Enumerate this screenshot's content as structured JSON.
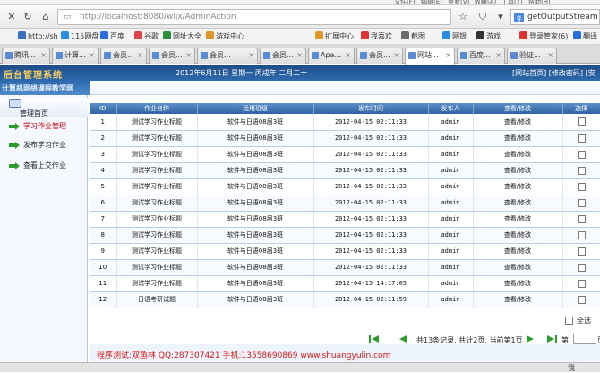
{
  "browser": {
    "url_host": "http://localhost",
    "url_path": ":8080/wljx/AdminAction",
    "search_text": "getOutputStream",
    "top_fragments": [
      "文件(F)",
      "编辑(E)",
      "查看(V)",
      "收藏(A)",
      "工具(T)",
      "帮助(H)"
    ],
    "bookmarks": [
      {
        "label": "http://sh",
        "color": "#3b6fc1"
      },
      {
        "label": "115网盘",
        "color": "#2a8de0"
      },
      {
        "label": "百度",
        "color": "#2a6be0"
      },
      {
        "label": "谷歌",
        "color": "#d44"
      },
      {
        "label": "网址大全",
        "color": "#2c8f3a"
      },
      {
        "label": "游戏中心",
        "color": "#e0962a"
      },
      {
        "label": "扩展中心",
        "color": "#e0962a"
      },
      {
        "label": "我喜欢",
        "color": "#d33"
      },
      {
        "label": "截图",
        "color": "#6b6b6b"
      },
      {
        "label": "网银",
        "color": "#2a8de0"
      },
      {
        "label": "游戏",
        "color": "#333"
      },
      {
        "label": "登录管家(6)",
        "color": "#d33"
      },
      {
        "label": "翻译",
        "color": "#2a6be0"
      }
    ],
    "tabs": [
      {
        "label": "腾讯..."
      },
      {
        "label": "计算..."
      },
      {
        "label": "会员..."
      },
      {
        "label": "会员..."
      },
      {
        "label": "会员..."
      },
      {
        "label": "会员..."
      },
      {
        "label": "Apa..."
      },
      {
        "label": "会员..."
      },
      {
        "label": "网站..."
      },
      {
        "label": "百度..."
      },
      {
        "label": "验证..."
      }
    ]
  },
  "app": {
    "title": "后台管理系统",
    "date": "2012年6月11日 星期一 丙戌年 二月二十",
    "link_home": "[网站首页]",
    "link_password": "[修改密码]",
    "link_safe": "[安",
    "subtitle": "计算机网络课程教学网"
  },
  "sidebar": {
    "header": "管理首页",
    "items": [
      {
        "label": "学习作业管理",
        "selected": true
      },
      {
        "label": "发布学习作业",
        "selected": false
      },
      {
        "label": "查看上交作业",
        "selected": false
      }
    ]
  },
  "table": {
    "headers": [
      "ID",
      "作业名称",
      "适用班级",
      "发布时间",
      "发布人",
      "查看/修改",
      "选择"
    ],
    "rows": [
      {
        "id": "1",
        "name": "测试学习作业标题",
        "cls": "软件与日语08届3班",
        "time": "2012-04-15 02:11:33",
        "by": "admin",
        "action": "查看/修改"
      },
      {
        "id": "2",
        "name": "测试学习作业标题",
        "cls": "软件与日语08届3班",
        "time": "2012-04-15 02:11:33",
        "by": "admin",
        "action": "查看/修改"
      },
      {
        "id": "3",
        "name": "测试学习作业标题",
        "cls": "软件与日语08届3班",
        "time": "2012-04-15 02:11:33",
        "by": "admin",
        "action": "查看/修改"
      },
      {
        "id": "4",
        "name": "测试学习作业标题",
        "cls": "软件与日语08届3班",
        "time": "2012-04-15 02:11:33",
        "by": "admin",
        "action": "查看/修改"
      },
      {
        "id": "5",
        "name": "测试学习作业标题",
        "cls": "软件与日语08届3班",
        "time": "2012-04-15 02:11:33",
        "by": "admin",
        "action": "查看/修改"
      },
      {
        "id": "6",
        "name": "测试学习作业标题",
        "cls": "软件与日语08届3班",
        "time": "2012-04-15 02:11:33",
        "by": "admin",
        "action": "查看/修改"
      },
      {
        "id": "7",
        "name": "测试学习作业标题",
        "cls": "软件与日语08届3班",
        "time": "2012-04-15 02:11:33",
        "by": "admin",
        "action": "查看/修改"
      },
      {
        "id": "8",
        "name": "测试学习作业标题",
        "cls": "软件与日语08届3班",
        "time": "2012-04-15 02:11:33",
        "by": "admin",
        "action": "查看/修改"
      },
      {
        "id": "9",
        "name": "测试学习作业标题",
        "cls": "软件与日语08届3班",
        "time": "2012-04-15 02:11:33",
        "by": "admin",
        "action": "查看/修改"
      },
      {
        "id": "10",
        "name": "测试学习作业标题",
        "cls": "软件与日语08届3班",
        "time": "2012-04-15 02:11:33",
        "by": "admin",
        "action": "查看/修改"
      },
      {
        "id": "11",
        "name": "测试学习作业标题",
        "cls": "软件与日语08届3班",
        "time": "2012-04-15 14:17:05",
        "by": "admin",
        "action": "查看/修改"
      },
      {
        "id": "12",
        "name": "日语考研试题",
        "cls": "软件与日语08届3班",
        "time": "2012-04-15 02:11:59",
        "by": "admin",
        "action": "查看/修改"
      }
    ],
    "select_all": "全选"
  },
  "pager": {
    "info": "共13条记录, 共计2页, 当前第1页",
    "goto_label": "第",
    "page_input": "",
    "goto_suffix": "页"
  },
  "footer": {
    "text": "程序测试:双鱼林 QQ:287307421 手机:13558690869 www.shuangyulin.com"
  },
  "status": {
    "right_label": "我"
  },
  "colors": {
    "header_blue": "#1d4c86",
    "title_gold": "#ffcf5a",
    "selected_red": "#c0000e",
    "footer_red": "#d81818",
    "arrow_green": "#2e9b2e"
  }
}
